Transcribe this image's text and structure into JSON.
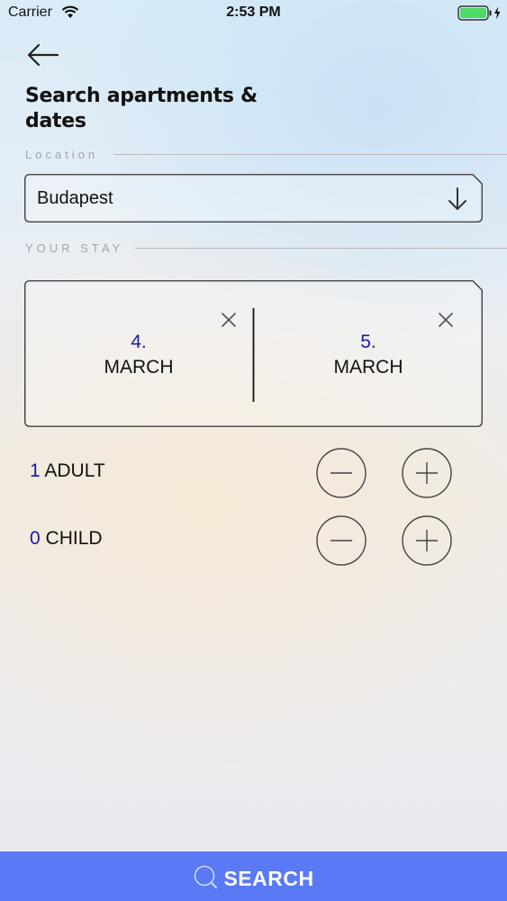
{
  "status_bar": {
    "carrier": "Carrier",
    "time": "2:53 PM"
  },
  "header": {
    "title": "Search apartments & dates"
  },
  "location": {
    "section_label": "Location",
    "value": "Budapest"
  },
  "stay": {
    "section_label": "YOUR STAY",
    "check_in": {
      "day": "4.",
      "month": "MARCH"
    },
    "check_out": {
      "day": "5.",
      "month": "MARCH"
    }
  },
  "guests": {
    "adult": {
      "count": "1",
      "label": "ADULT"
    },
    "child": {
      "count": "0",
      "label": "CHILD"
    }
  },
  "search_button": {
    "label": "SEARCH"
  },
  "colors": {
    "accent": "#5a79f4",
    "value_blue": "#1a1aa6",
    "battery": "#4cd964"
  }
}
